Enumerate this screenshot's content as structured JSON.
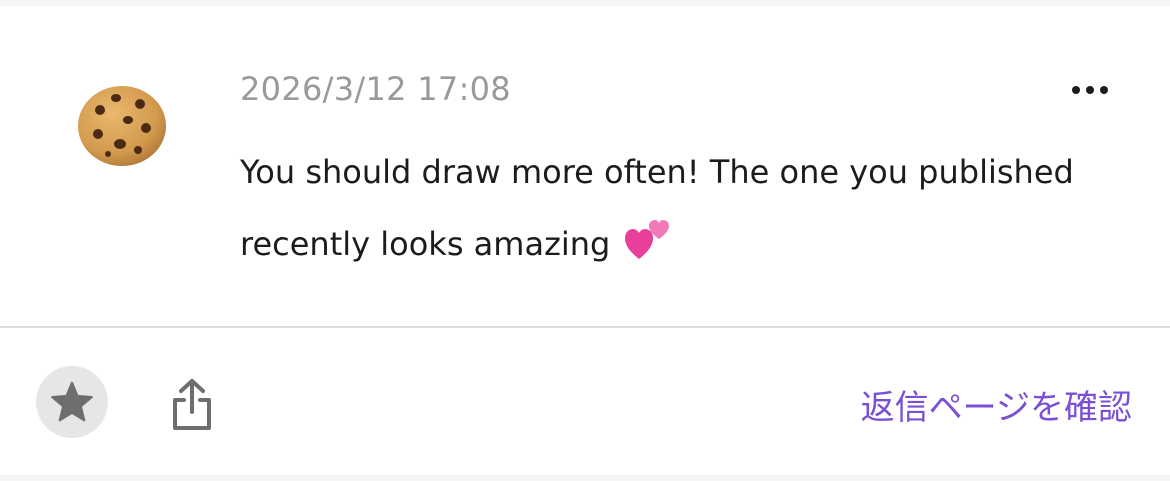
{
  "post": {
    "avatar_icon": "cookie-icon",
    "timestamp": "2026/3/12 17:08",
    "comment_line1": "You should draw more often! The one you published",
    "comment_line2": "recently looks amazing",
    "comment_emoji_icon": "two-hearts-icon"
  },
  "toolbar": {
    "more_icon": "more-options-icon",
    "star_icon": "star-icon",
    "share_icon": "share-icon",
    "reply_label": "返信ページを確認"
  },
  "colors": {
    "accent": "#7a4fd6",
    "timestamp": "#9a9a9a",
    "star_bg": "#e6e6e6",
    "icon_gray": "#6e6e6e"
  }
}
